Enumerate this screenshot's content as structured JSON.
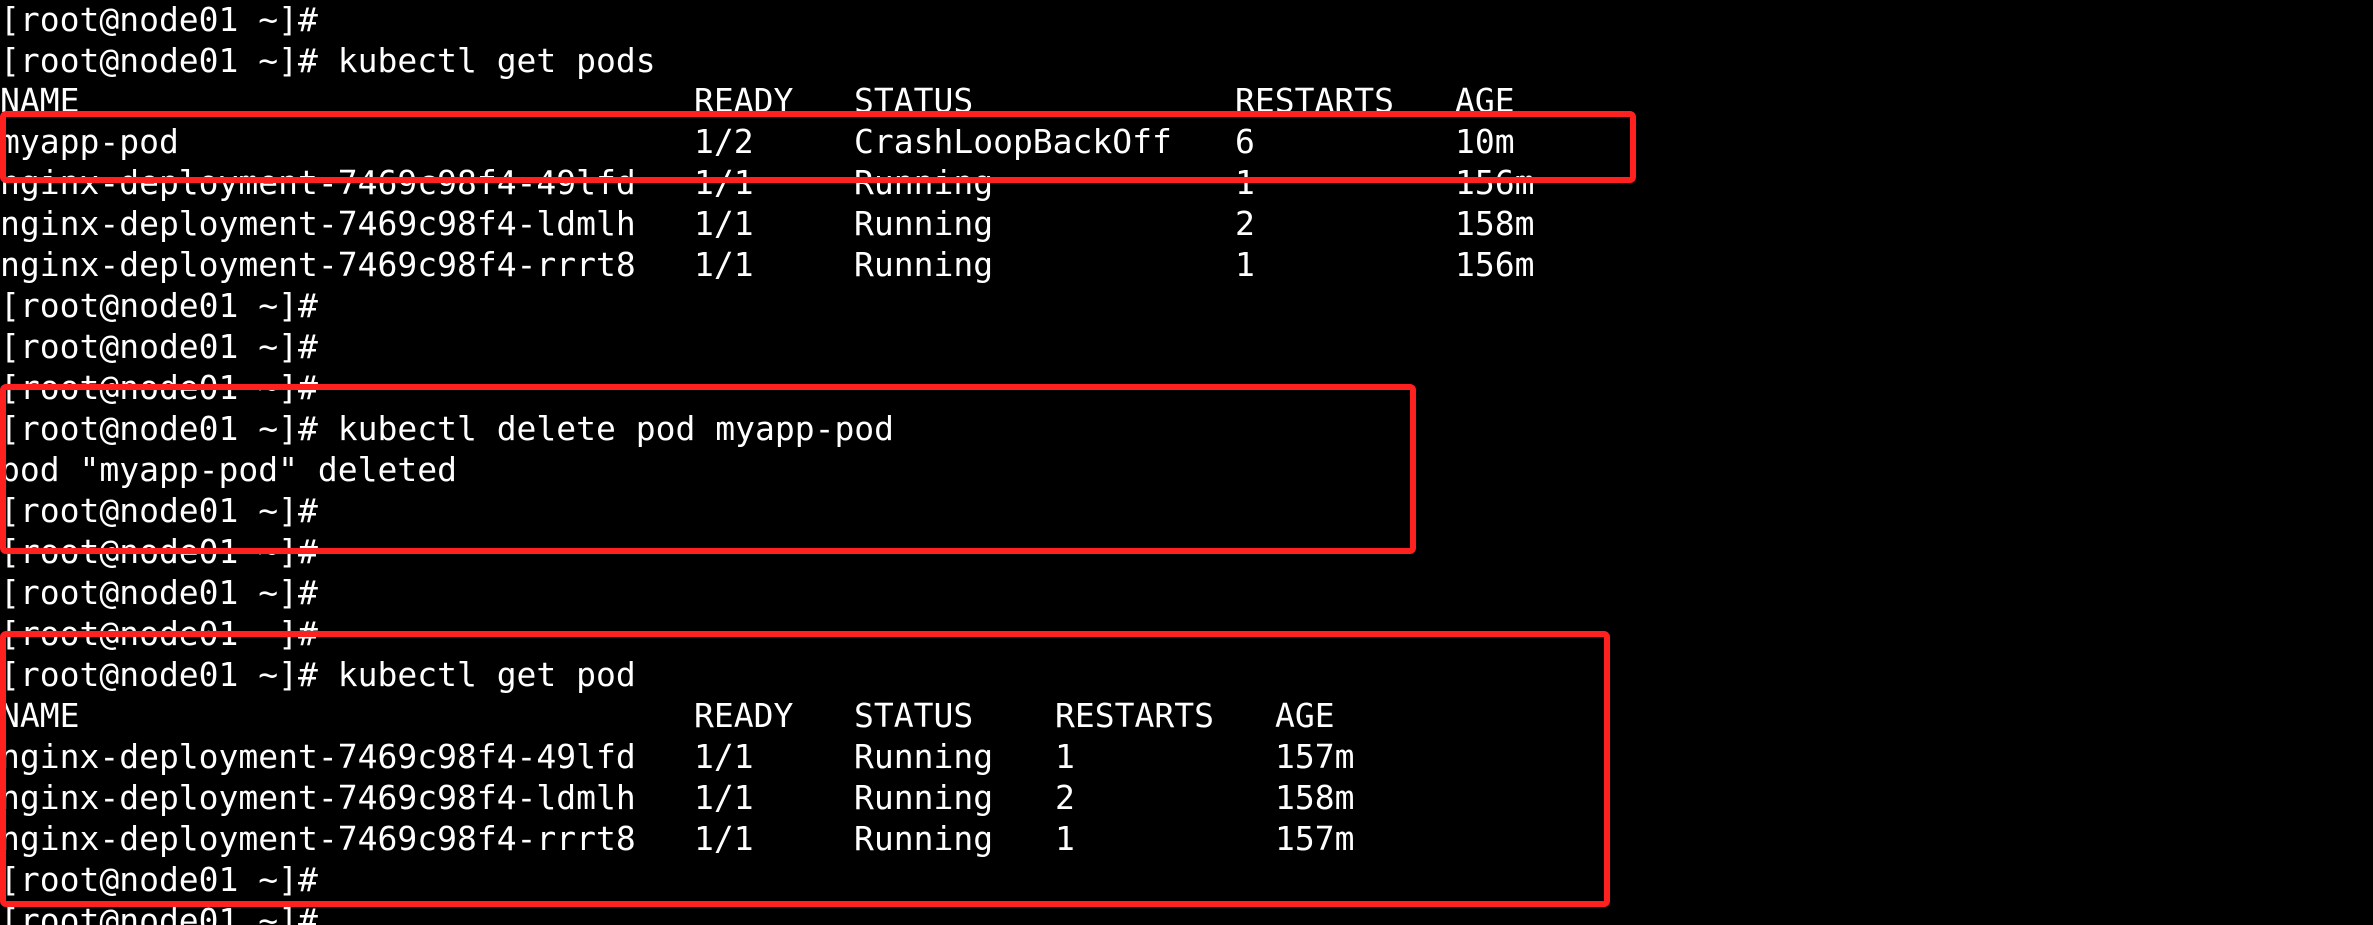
{
  "colors": {
    "background": "#000000",
    "text": "#ffffff",
    "highlight": "#ff2020"
  },
  "prompt": "[root@node01 ~]#",
  "commands": {
    "get_pods": "[root@node01 ~]# kubectl get pods",
    "delete_pod": "[root@node01 ~]# kubectl delete pod myapp-pod",
    "get_pod": "[root@node01 ~]# kubectl get pod"
  },
  "delete_output": "pod \"myapp-pod\" deleted",
  "table1": {
    "headers": {
      "name": "NAME",
      "ready": "READY",
      "status": "STATUS",
      "restarts": "RESTARTS",
      "age": "AGE"
    },
    "rows": [
      {
        "name": "myapp-pod",
        "ready": "1/2",
        "status": "CrashLoopBackOff",
        "restarts": "6",
        "age": "10m"
      },
      {
        "name": "nginx-deployment-7469c98f4-49lfd",
        "ready": "1/1",
        "status": "Running",
        "restarts": "1",
        "age": "156m"
      },
      {
        "name": "nginx-deployment-7469c98f4-ldmlh",
        "ready": "1/1",
        "status": "Running",
        "restarts": "2",
        "age": "158m"
      },
      {
        "name": "nginx-deployment-7469c98f4-rrrt8",
        "ready": "1/1",
        "status": "Running",
        "restarts": "1",
        "age": "156m"
      }
    ]
  },
  "table2": {
    "headers": {
      "name": "NAME",
      "ready": "READY",
      "status": "STATUS",
      "restarts": "RESTARTS",
      "age": "AGE"
    },
    "rows": [
      {
        "name": "nginx-deployment-7469c98f4-49lfd",
        "ready": "1/1",
        "status": "Running",
        "restarts": "1",
        "age": "157m"
      },
      {
        "name": "nginx-deployment-7469c98f4-ldmlh",
        "ready": "1/1",
        "status": "Running",
        "restarts": "2",
        "age": "158m"
      },
      {
        "name": "nginx-deployment-7469c98f4-rrrt8",
        "ready": "1/1",
        "status": "Running",
        "restarts": "1",
        "age": "157m"
      }
    ]
  }
}
